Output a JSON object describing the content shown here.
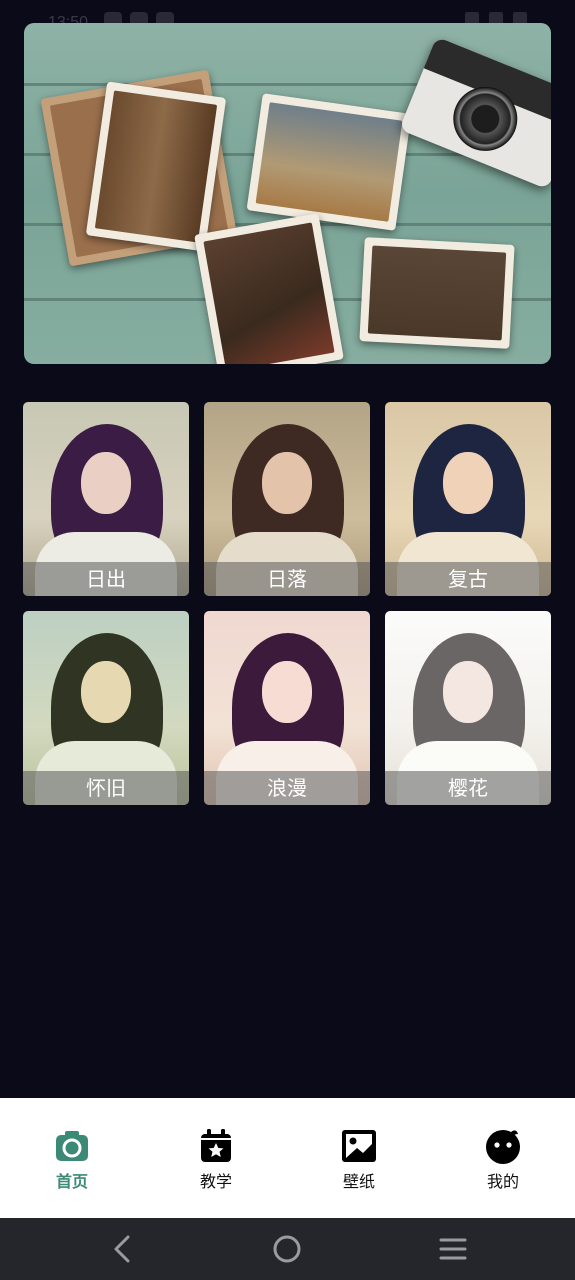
{
  "status_bar": {
    "time": "13:50"
  },
  "hero": {
    "image_icon": "vintage-photos-camera-image"
  },
  "filters": [
    {
      "label": "日出",
      "tint": "#b9b79f"
    },
    {
      "label": "日落",
      "tint": "#a89a79"
    },
    {
      "label": "复古",
      "tint": "#cbb796"
    },
    {
      "label": "怀旧",
      "tint": "#b7c2a1"
    },
    {
      "label": "浪漫",
      "tint": "#e4c9c0"
    },
    {
      "label": "樱花",
      "tint": "#f3f1ee"
    }
  ],
  "tabs": [
    {
      "label": "首页",
      "icon": "camera-icon",
      "active": true
    },
    {
      "label": "教学",
      "icon": "calendar-star-icon",
      "active": false
    },
    {
      "label": "壁纸",
      "icon": "image-icon",
      "active": false
    },
    {
      "label": "我的",
      "icon": "face-icon",
      "active": false
    }
  ],
  "navigation": {
    "back": "back-icon",
    "home": "home-icon",
    "menu": "menu-icon"
  },
  "colors": {
    "background": "#0a0a18",
    "accent": "#3c8a75",
    "tabbar": "#ffffff",
    "navbar": "#25262b"
  }
}
